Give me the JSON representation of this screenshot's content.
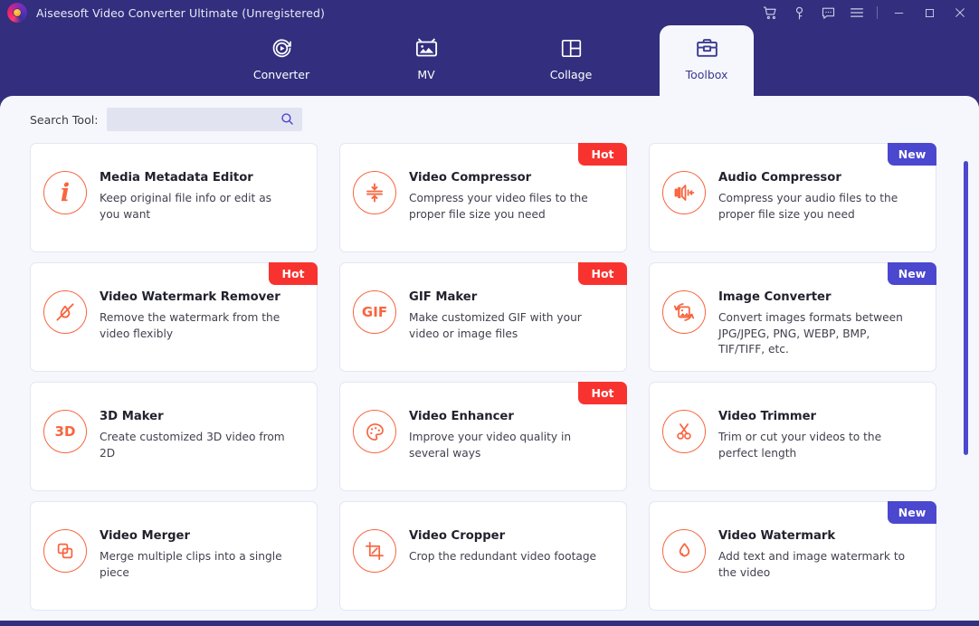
{
  "window": {
    "title": "Aiseesoft Video Converter Ultimate (Unregistered)",
    "logo_icon": "aiseesoft-logo-icon",
    "titlebar_icons": [
      {
        "name": "cart-icon",
        "label": "Cart"
      },
      {
        "name": "key-icon",
        "label": "Register"
      },
      {
        "name": "feedback-icon",
        "label": "Feedback"
      },
      {
        "name": "menu-icon",
        "label": "Menu"
      }
    ],
    "controls": [
      {
        "name": "minimize-button",
        "label": "Minimize"
      },
      {
        "name": "maximize-button",
        "label": "Maximize"
      },
      {
        "name": "close-button",
        "label": "Close"
      }
    ],
    "colors": {
      "header_bg": "#332f7e",
      "content_bg": "#f5f7fc",
      "accent_orange": "#f8653f",
      "accent_blue": "#4b47cf",
      "hot_red": "#f8332f"
    }
  },
  "nav": {
    "tabs": [
      {
        "label": "Converter",
        "icon": "converter-icon",
        "active": false
      },
      {
        "label": "MV",
        "icon": "mv-icon",
        "active": false
      },
      {
        "label": "Collage",
        "icon": "collage-icon",
        "active": false
      },
      {
        "label": "Toolbox",
        "icon": "toolbox-icon",
        "active": true
      }
    ]
  },
  "search": {
    "label": "Search Tool:",
    "value": "",
    "placeholder": "",
    "icon": "search-icon"
  },
  "scrollbar": {
    "orientation": "vertical",
    "thumb_position_percent": 0
  },
  "tools": [
    {
      "title": "Media Metadata Editor",
      "desc": "Keep original file info or edit as you want",
      "badge": "",
      "icon": "info-circle-icon"
    },
    {
      "title": "Video Compressor",
      "desc": "Compress your video files to the proper file size you need",
      "badge": "Hot",
      "icon": "compress-icon"
    },
    {
      "title": "Audio Compressor",
      "desc": "Compress your audio files to the proper file size you need",
      "badge": "New",
      "icon": "speaker-compress-icon"
    },
    {
      "title": "Video Watermark Remover",
      "desc": "Remove the watermark from the video flexibly",
      "badge": "Hot",
      "icon": "watermark-remove-icon"
    },
    {
      "title": "GIF Maker",
      "desc": "Make customized GIF with your video or image files",
      "badge": "Hot",
      "icon": "gif-icon"
    },
    {
      "title": "Image Converter",
      "desc": "Convert images formats between JPG/JPEG, PNG, WEBP, BMP, TIF/TIFF, etc.",
      "badge": "New",
      "icon": "image-convert-icon"
    },
    {
      "title": "3D Maker",
      "desc": "Create customized 3D video from 2D",
      "badge": "",
      "icon": "three-d-icon"
    },
    {
      "title": "Video Enhancer",
      "desc": "Improve your video quality in several ways",
      "badge": "Hot",
      "icon": "palette-icon"
    },
    {
      "title": "Video Trimmer",
      "desc": "Trim or cut your videos to the perfect length",
      "badge": "",
      "icon": "scissors-icon"
    },
    {
      "title": "Video Merger",
      "desc": "Merge multiple clips into a single piece",
      "badge": "",
      "icon": "merge-icon"
    },
    {
      "title": "Video Cropper",
      "desc": "Crop the redundant video footage",
      "badge": "",
      "icon": "crop-icon"
    },
    {
      "title": "Video Watermark",
      "desc": "Add text and image watermark to the video",
      "badge": "New",
      "icon": "droplet-icon"
    }
  ]
}
